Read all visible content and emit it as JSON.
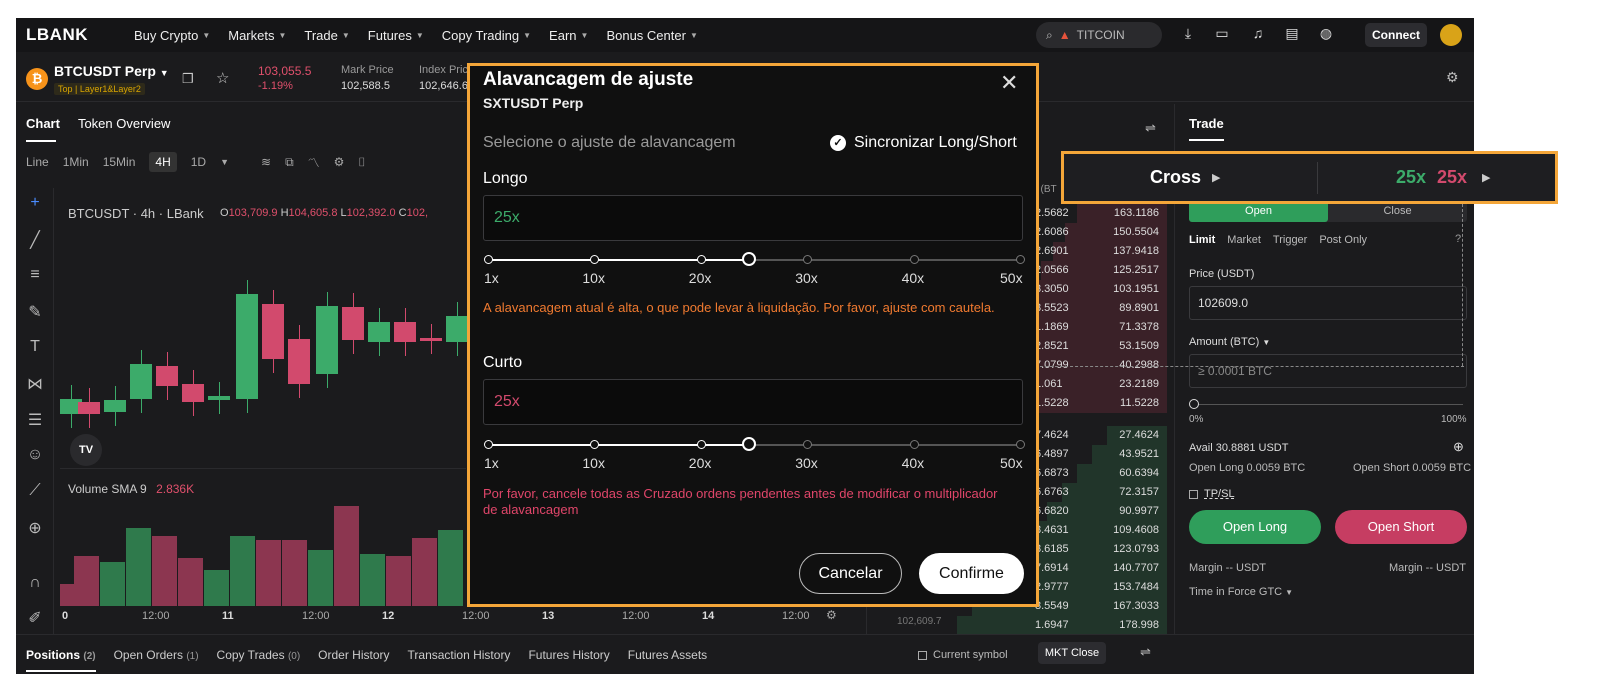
{
  "topnav": {
    "logo": "LBANK",
    "items": [
      "Buy Crypto",
      "Markets",
      "Trade",
      "Futures",
      "Copy Trading",
      "Earn",
      "Bonus Center"
    ],
    "search_text": "TITCOIN",
    "connect_label": "Connect"
  },
  "ticker": {
    "symbol": "BTCUSDT Perp",
    "tags": "Top | Layer1&Layer2",
    "last_price": "103,055.5",
    "change": "-1.19%",
    "mark_price_label": "Mark Price",
    "mark_price": "102,588.5",
    "index_price_label": "Index Pric",
    "index_price": "102,646.6"
  },
  "chart": {
    "tabs": [
      "Chart",
      "Token Overview"
    ],
    "timeframes": [
      "Line",
      "1Min",
      "15Min",
      "4H",
      "1D"
    ],
    "selected_timeframe": "4H",
    "title": "BTCUSDT · 4h · LBank",
    "ohlc": {
      "o": "103,709.9",
      "h": "104,605.8",
      "l": "102,392.0",
      "c": "102,"
    },
    "ohlc_labels": {
      "o": "O",
      "h": "H",
      "l": "L",
      "c": "C"
    },
    "volume_label": "Volume SMA 9",
    "volume_value": "2.836K",
    "x_ticks": [
      "0",
      "12:00",
      "11",
      "12:00",
      "12",
      "12:00",
      "13",
      "12:00",
      "14",
      "12:00"
    ],
    "tv_logo": "TV"
  },
  "orderbook": {
    "header_partial": "t (BT",
    "asks": [
      [
        "2.5682",
        "163.1186"
      ],
      [
        "2.6086",
        "150.5504"
      ],
      [
        "2.6901",
        "137.9418"
      ],
      [
        "2.0566",
        "125.2517"
      ],
      [
        "3.3050",
        "103.1951"
      ],
      [
        "8.5523",
        "89.8901"
      ],
      [
        "1.1869",
        "71.3378"
      ],
      [
        "2.8521",
        "53.1509"
      ],
      [
        "7.0799",
        "40.2988"
      ],
      [
        "1.061",
        "23.2189"
      ],
      [
        "1.5228",
        "11.5228"
      ]
    ],
    "bids": [
      [
        "7.4624",
        "27.4624"
      ],
      [
        "6.4897",
        "43.9521"
      ],
      [
        "6.6873",
        "60.6394"
      ],
      [
        "6.6763",
        "72.3157"
      ],
      [
        "6.6820",
        "90.9977"
      ],
      [
        "8.4631",
        "109.4608"
      ],
      [
        "8.6185",
        "123.0793"
      ],
      [
        "7.6914",
        "140.7707"
      ],
      [
        "2.9777",
        "153.7484"
      ],
      [
        "8.5549",
        "167.3033"
      ],
      [
        "1.6947",
        "178.998"
      ]
    ],
    "footer_price": "102,609.7"
  },
  "trade": {
    "title": "Trade",
    "open_label": "Open",
    "close_label": "Close",
    "order_types": [
      "Limit",
      "Market",
      "Trigger",
      "Post Only"
    ],
    "price_label": "Price (USDT)",
    "price_value": "102609.0",
    "amount_label": "Amount (BTC)",
    "amount_placeholder": "≥ 0.0001 BTC",
    "pct_min": "0%",
    "pct_max": "100%",
    "avail": "Avail 30.8881 USDT",
    "open_long_info": "Open Long 0.0059 BTC",
    "open_short_info": "Open Short 0.0059 BTC",
    "tpsl": "TP/SL",
    "open_long_button": "Open Long",
    "open_short_button": "Open Short",
    "margin_left": "Margin -- USDT",
    "margin_right": "Margin -- USDT",
    "time_in_force": "Time in Force GTC"
  },
  "callout": {
    "mode": "Cross",
    "long_leverage": "25x",
    "short_leverage": "25x"
  },
  "bottom": {
    "tabs": [
      {
        "label": "Positions",
        "count": "(2)"
      },
      {
        "label": "Open Orders",
        "count": "(1)"
      },
      {
        "label": "Copy Trades",
        "count": "(0)"
      },
      {
        "label": "Order History",
        "count": ""
      },
      {
        "label": "Transaction History",
        "count": ""
      },
      {
        "label": "Futures History",
        "count": ""
      },
      {
        "label": "Futures Assets",
        "count": ""
      }
    ],
    "current_symbol": "Current symbol",
    "mkt_close": "MKT Close"
  },
  "modal": {
    "title": "Alavancagem de ajuste",
    "subtitle": "SXTUSDT Perp",
    "select_label": "Selecione o ajuste de alavancagem",
    "sync_label": "Sincronizar Long/Short",
    "long_label": "Longo",
    "long_value": "25x",
    "short_label": "Curto",
    "short_value": "25x",
    "slider_ticks": [
      "1x",
      "10x",
      "20x",
      "30x",
      "40x",
      "50x"
    ],
    "leverage_fraction": 0.49,
    "warning_high": "A alavancagem atual é alta, o que pode levar à liquidação. Por favor, ajuste com cautela.",
    "warning_cancel": "Por favor, cancele todas as Cruzado ordens pendentes antes de modificar o multiplicador de alavancagem",
    "cancel_label": "Cancelar",
    "confirm_label": "Confirme"
  },
  "colors": {
    "accent_orange": "#f4a639",
    "green": "#3cab6a",
    "red": "#d24a6d",
    "warning_orange": "#f07a30",
    "warning_red": "#e0466a"
  }
}
